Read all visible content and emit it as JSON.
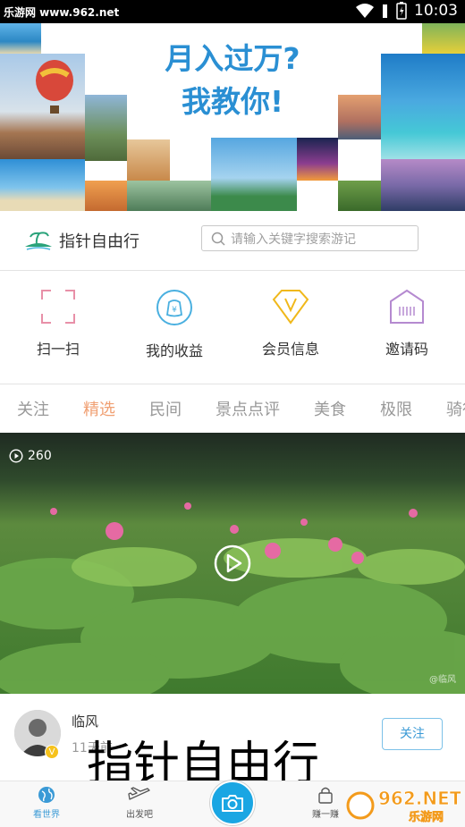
{
  "status_bar": {
    "watermark": "乐游网 www.962.net",
    "time": "10:03"
  },
  "banner": {
    "line1": "月入过万?",
    "line2": "我教你!"
  },
  "brand": {
    "name": "指针自由行"
  },
  "search": {
    "placeholder": "请输入关键字搜索游记"
  },
  "actions": [
    {
      "label": "扫一扫",
      "icon": "scan-icon"
    },
    {
      "label": "我的收益",
      "icon": "money-bag-icon"
    },
    {
      "label": "会员信息",
      "icon": "diamond-icon"
    },
    {
      "label": "邀请码",
      "icon": "invite-house-icon"
    }
  ],
  "tabs": [
    "关注",
    "精选",
    "民间",
    "景点点评",
    "美食",
    "极限",
    "骑行"
  ],
  "active_tab": "精选",
  "video": {
    "views": "260",
    "watermark": "@临风"
  },
  "post": {
    "author": "临风",
    "time": "11天前",
    "follow_label": "关注",
    "badge": "V"
  },
  "caption": "指针自由行",
  "tabbar": [
    {
      "label": "看世界",
      "icon": "globe-icon"
    },
    {
      "label": "出发吧",
      "icon": "plane-icon"
    },
    {
      "label": "赚一赚",
      "icon": "lock-icon"
    }
  ],
  "site_watermark": {
    "big": "962.NET",
    "small": "乐游网"
  },
  "colors": {
    "accent": "#1aa6e3",
    "active_tab": "#f0a073",
    "banner_text": "#2a8fd3"
  }
}
